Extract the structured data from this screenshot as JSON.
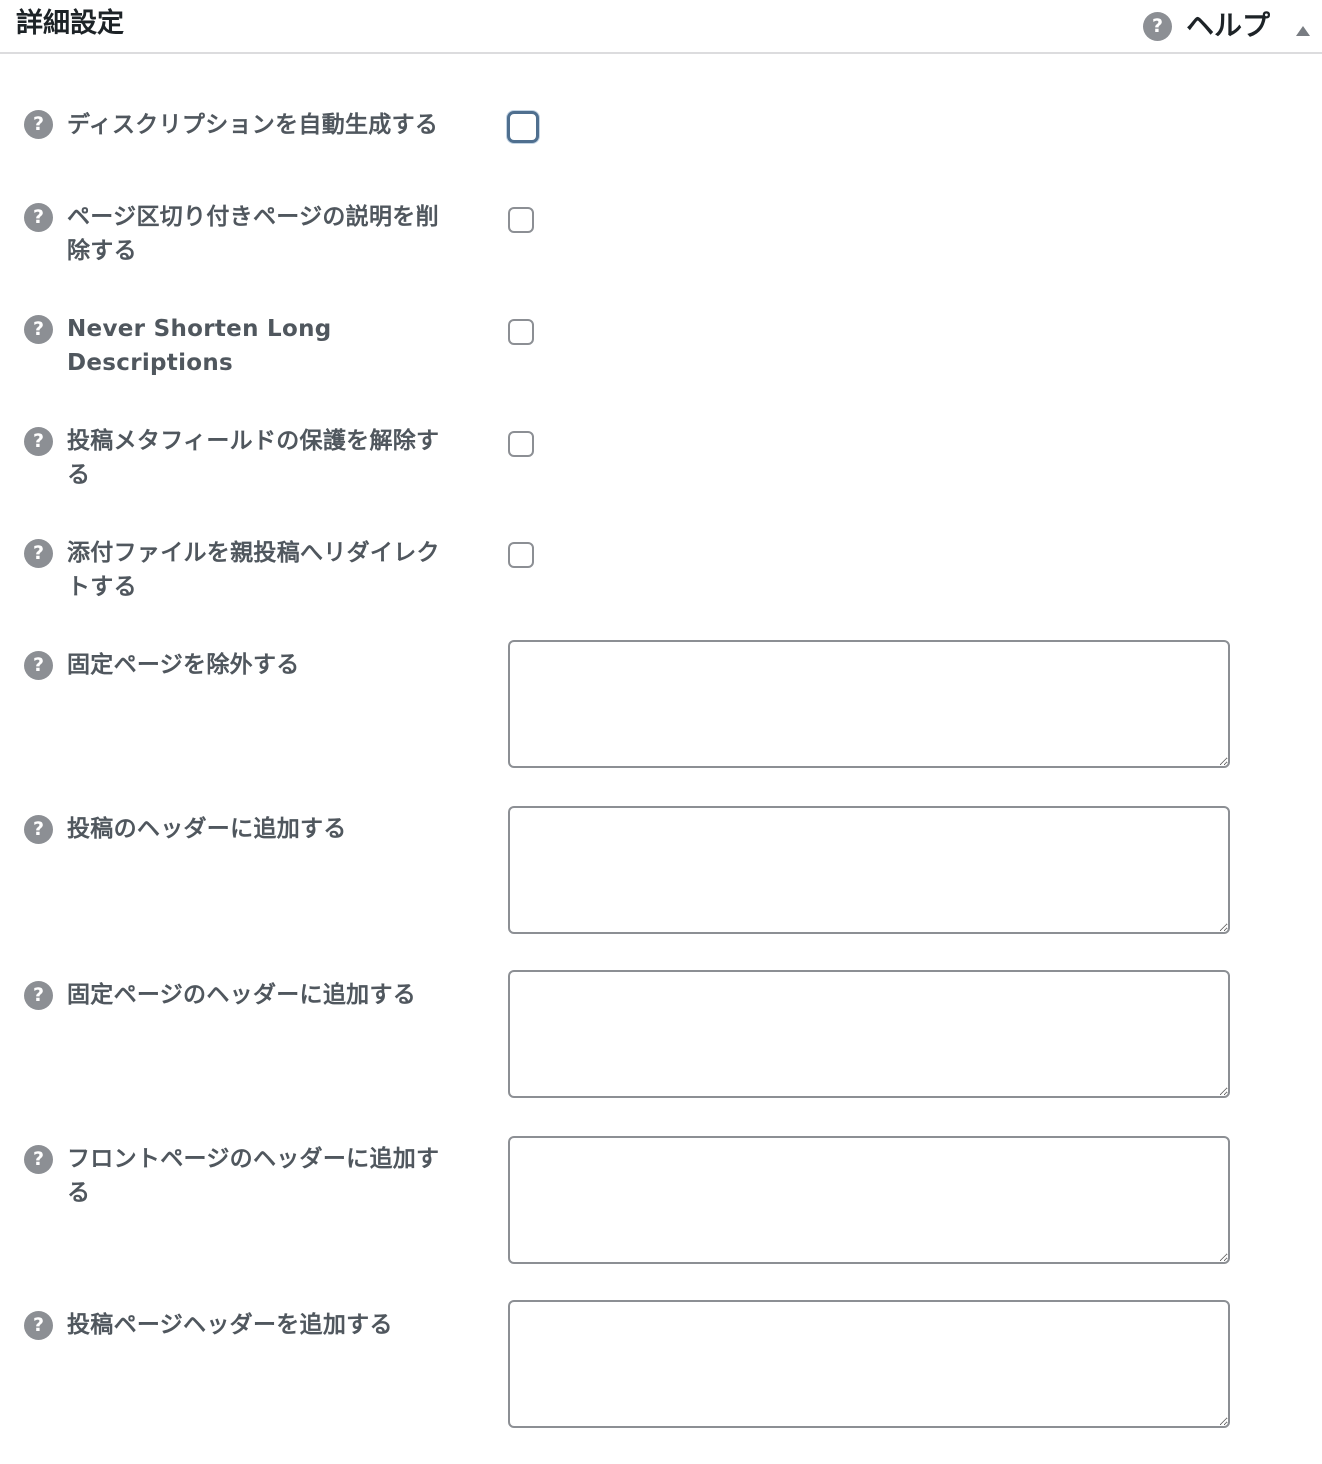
{
  "header": {
    "title": "詳細設定",
    "help_label": "ヘルプ",
    "help_icon": "question-circle-icon",
    "toggle_icon": "arrow-up-icon"
  },
  "help_glyph": "?",
  "checkbox_rows": [
    {
      "label": "ディスクリプションを自動生成する",
      "checked": false,
      "focused": true
    },
    {
      "label": "ページ区切り付きページの説明を削除する",
      "checked": false
    },
    {
      "label": "Never Shorten Long Descriptions",
      "checked": false
    },
    {
      "label": "投稿メタフィールドの保護を解除する",
      "checked": false
    },
    {
      "label": "添付ファイルを親投稿へリダイレクトする",
      "checked": false
    }
  ],
  "textarea_rows": [
    {
      "label": "固定ページを除外する",
      "value": ""
    },
    {
      "label": "投稿のヘッダーに追加する",
      "value": ""
    },
    {
      "label": "固定ページのヘッダーに追加する",
      "value": ""
    },
    {
      "label": "フロントページのヘッダーに追加する",
      "value": ""
    },
    {
      "label": "投稿ページヘッダーを追加する",
      "value": ""
    }
  ]
}
